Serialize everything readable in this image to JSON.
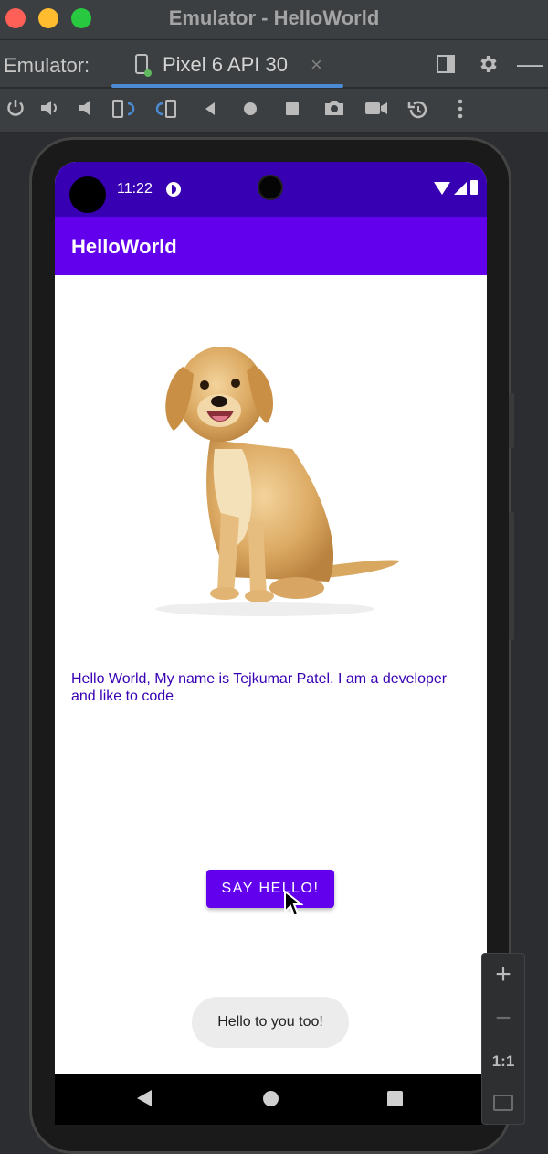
{
  "window": {
    "title": "Emulator - HelloWorld"
  },
  "tabbar": {
    "label": "Emulator:",
    "device_tab": "Pixel 6 API 30",
    "close_glyph": "×",
    "icons": [
      "layout-icon",
      "gear-icon",
      "minimize-icon"
    ]
  },
  "toolbar": {
    "icons": [
      "power-icon",
      "volume-up-icon",
      "volume-down-icon",
      "rotate-left-icon",
      "rotate-right-icon",
      "back-icon",
      "home-icon",
      "overview-icon",
      "camera-icon",
      "record-icon",
      "snapshot-icon",
      "more-icon"
    ]
  },
  "status_bar": {
    "time": "11:22"
  },
  "app": {
    "title": "HelloWorld",
    "description": "Hello World, My name is Tejkumar Patel. I am a developer and like to code",
    "button_label": "SAY HELLO!",
    "toast": "Hello to you too!"
  },
  "zoom_panel": {
    "plus": "+",
    "minus": "−",
    "one_to_one": "1:1"
  },
  "colors": {
    "status_bar": "#3700b3",
    "app_bar": "#6200ee",
    "accent_text": "#3700b3",
    "button": "#6200ee",
    "tab_underline": "#4c8bd3"
  }
}
